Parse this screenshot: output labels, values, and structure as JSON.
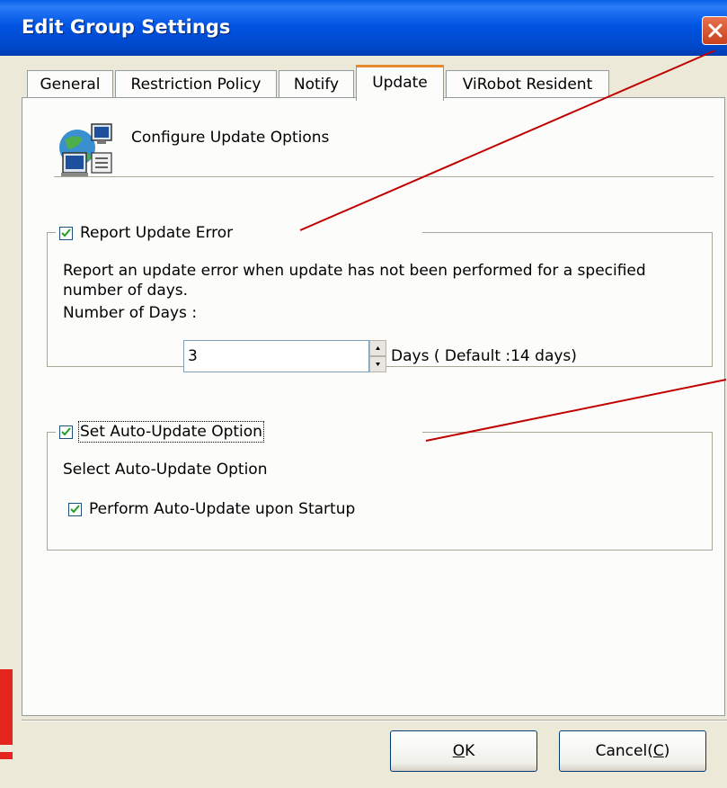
{
  "window": {
    "title": "Edit Group Settings"
  },
  "tabs": [
    {
      "label": "General"
    },
    {
      "label": "Restriction Policy"
    },
    {
      "label": "Notify"
    },
    {
      "label": "Update",
      "active": true
    },
    {
      "label": "ViRobot Resident"
    }
  ],
  "header": {
    "text": "Configure Update Options",
    "icon": "network-computers-icon"
  },
  "report_group": {
    "checkbox_label": "Report Update Error",
    "checked": true,
    "description": "Report an update error when update has not been performed for a specified number of days.",
    "days_label": "Number of Days :",
    "days_value": "3",
    "days_suffix": "Days ( Default :14 days)"
  },
  "auto_group": {
    "checkbox_label": "Set Auto-Update Option",
    "checked": true,
    "select_label": "Select Auto-Update Option",
    "startup_label": "Perform Auto-Update upon Startup",
    "startup_checked": true
  },
  "buttons": {
    "ok_prefix": "",
    "ok_mnemonic": "O",
    "ok_rest": "K",
    "cancel_prefix": "Cancel(",
    "cancel_mnemonic": "C",
    "cancel_rest": ")"
  },
  "colors": {
    "titlebar": "#0054e3",
    "tab_highlight": "#e68b2c",
    "annotation_line": "#c00000",
    "close_button": "#d9542e"
  }
}
